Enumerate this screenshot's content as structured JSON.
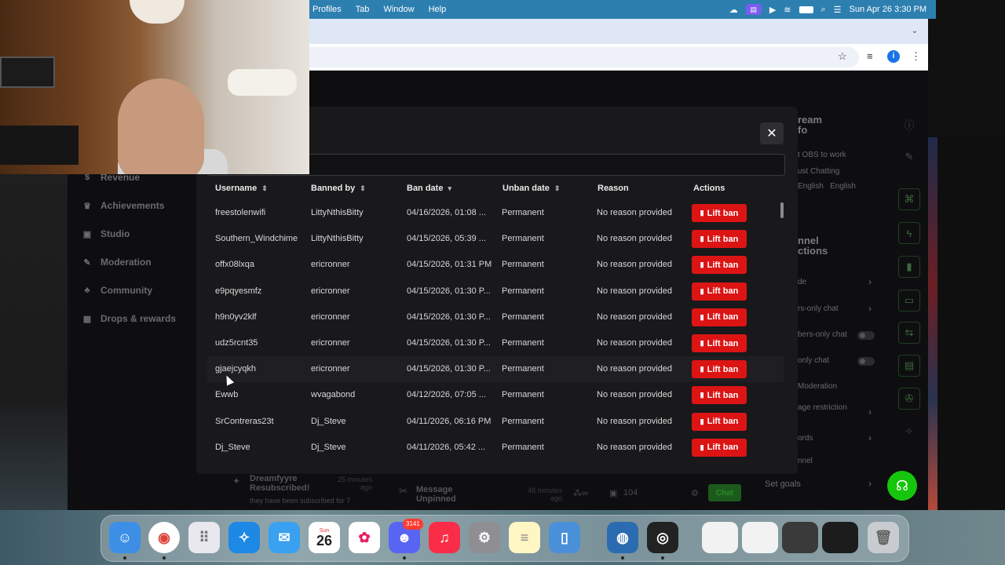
{
  "menubar": {
    "items": [
      "Profiles",
      "Tab",
      "Window",
      "Help"
    ],
    "datetime": "Sun Apr 26  3:30 PM"
  },
  "left_nav": {
    "items": [
      {
        "label": "Revenue",
        "icon": "revenue-icon"
      },
      {
        "label": "Achievements",
        "icon": "trophy-icon"
      },
      {
        "label": "Studio",
        "icon": "studio-icon"
      },
      {
        "label": "Moderation",
        "icon": "wrench-icon"
      },
      {
        "label": "Community",
        "icon": "community-icon"
      },
      {
        "label": "Drops & rewards",
        "icon": "gift-icon"
      }
    ]
  },
  "right_column": {
    "stream_info_title": "ream\nfo",
    "stream_lines": [
      "t OBS to work",
      "ust Chatting",
      "English   English"
    ],
    "channel_actions_title": "nnel\nctions",
    "rows": [
      "de",
      "rs-only chat",
      "bers-only chat",
      "only chat",
      "Moderation",
      "age restriction",
      "ords",
      "nnel",
      "Set goals"
    ]
  },
  "activity": {
    "item1_title": "Dreamfyyre\nResubscribed!",
    "item1_sub": "they have been subscribed for 7",
    "item1_time": "25 minutes\nago",
    "item2_title": "Message\nUnpinned",
    "item2_time": "48 minutes\nago",
    "viewers": "104",
    "chat_label": "Chat"
  },
  "modal": {
    "search_value": "",
    "columns": [
      "Username",
      "Banned by",
      "Ban date",
      "Unban date",
      "Reason",
      "Actions"
    ],
    "action_label": "Lift ban",
    "rows": [
      {
        "username": "freestolenwifi",
        "banned_by": "LittyNthisBitty",
        "ban_date": "04/16/2026, 01:08 ...",
        "unban_date": "Permanent",
        "reason": "No reason provided"
      },
      {
        "username": "Southern_Windchime",
        "banned_by": "LittyNthisBitty",
        "ban_date": "04/15/2026, 05:39 ...",
        "unban_date": "Permanent",
        "reason": "No reason provided"
      },
      {
        "username": "offx08lxqa",
        "banned_by": "ericronner",
        "ban_date": "04/15/2026, 01:31 PM",
        "unban_date": "Permanent",
        "reason": "No reason provided"
      },
      {
        "username": "e9pqyesmfz",
        "banned_by": "ericronner",
        "ban_date": "04/15/2026, 01:30 P...",
        "unban_date": "Permanent",
        "reason": "No reason provided"
      },
      {
        "username": "h9n0yv2klf",
        "banned_by": "ericronner",
        "ban_date": "04/15/2026, 01:30 P...",
        "unban_date": "Permanent",
        "reason": "No reason provided"
      },
      {
        "username": "udz5rcnt35",
        "banned_by": "ericronner",
        "ban_date": "04/15/2026, 01:30 P...",
        "unban_date": "Permanent",
        "reason": "No reason provided"
      },
      {
        "username": "gjaejcyqkh",
        "banned_by": "ericronner",
        "ban_date": "04/15/2026, 01:30 P...",
        "unban_date": "Permanent",
        "reason": "No reason provided"
      },
      {
        "username": "Ewwb",
        "banned_by": "wvagabond",
        "ban_date": "04/12/2026, 07:05 ...",
        "unban_date": "Permanent",
        "reason": "No reason provided"
      },
      {
        "username": "SrContreras23t",
        "banned_by": "Dj_Steve",
        "ban_date": "04/11/2026, 06:16 PM",
        "unban_date": "Permanent",
        "reason": "No reason provided"
      },
      {
        "username": "Dj_Steve",
        "banned_by": "Dj_Steve",
        "ban_date": "04/11/2026, 05:42 ...",
        "unban_date": "Permanent",
        "reason": "No reason provided"
      }
    ]
  },
  "dock": {
    "calendar_month": "Sun",
    "calendar_day": "26",
    "discord_badge": "3141",
    "apps": [
      "finder",
      "chrome",
      "launchpad",
      "safari",
      "mail",
      "calendar",
      "photos",
      "discord",
      "music",
      "settings",
      "notes",
      "files",
      "screen-capture",
      "obs"
    ]
  },
  "colors": {
    "accent_red": "#dc1414",
    "menubar_blue": "#2d7fb0",
    "fab_green": "#16c60c"
  }
}
